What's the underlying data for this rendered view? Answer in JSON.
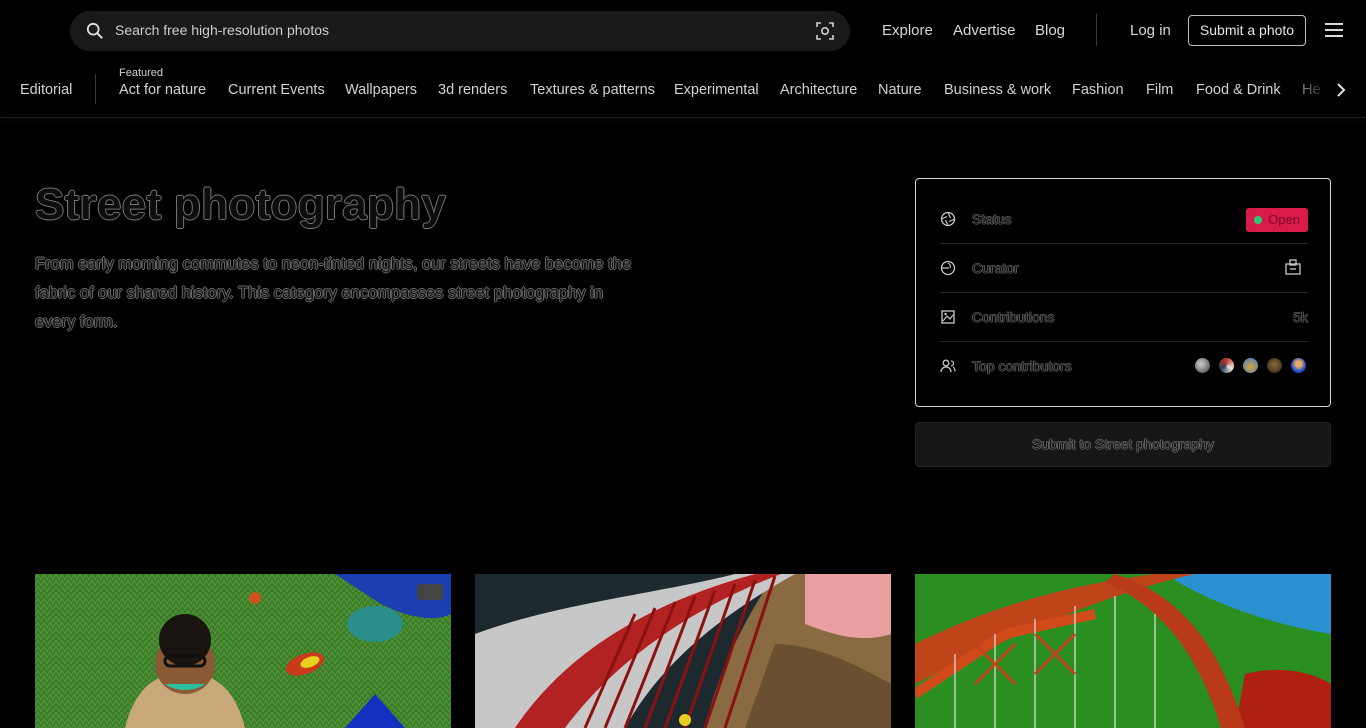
{
  "header": {
    "search_placeholder": "Search free high-resolution photos",
    "nav": [
      "Explore",
      "Advertise",
      "Blog"
    ],
    "login": "Log in",
    "submit": "Submit a photo"
  },
  "categories": {
    "editorial": "Editorial",
    "featured_label": "Featured",
    "items": [
      "Act for nature",
      "Current Events",
      "Wallpapers",
      "3d renders",
      "Textures & patterns",
      "Experimental",
      "Architecture",
      "Nature",
      "Business & work",
      "Fashion",
      "Film",
      "Food & Drink",
      "He"
    ]
  },
  "topic": {
    "title": "Street photography",
    "description": "From early morning commutes to neon-tinted nights, our streets have become the fabric of our shared history. This category encompasses street photography in every form."
  },
  "info": {
    "status_label": "Status",
    "status_value": "Open",
    "curator_label": "Curator",
    "contributions_label": "Contributions",
    "contributions_value": "5k",
    "top_contributors_label": "Top contributors"
  },
  "submit_topic": "Submit to Street photography",
  "colors": {
    "status_badge": "#d81b4a",
    "status_dot": "#2ecc71"
  }
}
